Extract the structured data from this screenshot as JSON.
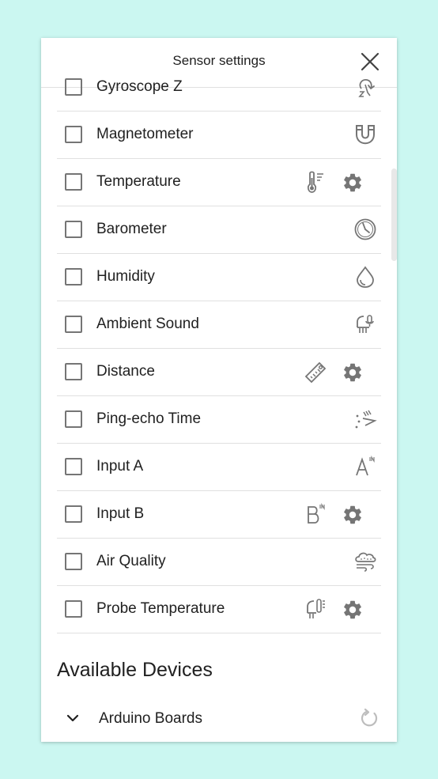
{
  "dialog": {
    "title": "Sensor settings",
    "close_icon": "close-icon"
  },
  "sensors": [
    {
      "label": "Gyroscope Z",
      "icon": "gyroscope-z-icon",
      "has_settings": false
    },
    {
      "label": "Magnetometer",
      "icon": "magnet-icon",
      "has_settings": false
    },
    {
      "label": "Temperature",
      "icon": "thermometer-icon",
      "has_settings": true
    },
    {
      "label": "Barometer",
      "icon": "barometer-gauge-icon",
      "has_settings": false
    },
    {
      "label": "Humidity",
      "icon": "water-drop-icon",
      "has_settings": false
    },
    {
      "label": "Ambient Sound",
      "icon": "microphone-icon",
      "has_settings": false
    },
    {
      "label": "Distance",
      "icon": "ruler-icon",
      "has_settings": true
    },
    {
      "label": "Ping-echo Time",
      "icon": "ping-echo-icon",
      "has_settings": false
    },
    {
      "label": "Input A",
      "icon": "input-a-icon",
      "has_settings": false
    },
    {
      "label": "Input B",
      "icon": "input-b-icon",
      "has_settings": true
    },
    {
      "label": "Air Quality",
      "icon": "air-quality-icon",
      "has_settings": false
    },
    {
      "label": "Probe Temperature",
      "icon": "probe-temperature-icon",
      "has_settings": true
    }
  ],
  "available_devices": {
    "title": "Available Devices",
    "groups": [
      {
        "label": "Arduino Boards",
        "expand_icon": "chevron-down-icon",
        "refresh_icon": "refresh-icon"
      }
    ]
  },
  "colors": {
    "background": "#cbf7f1",
    "icon": "#757575",
    "divider": "#e0e0e0"
  }
}
